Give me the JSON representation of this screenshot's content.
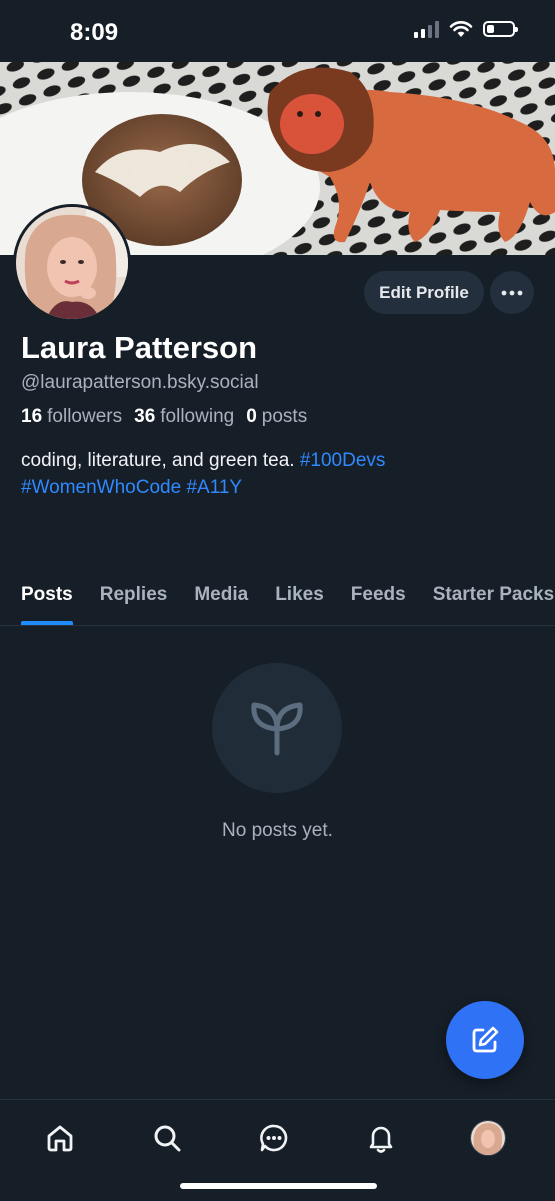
{
  "status_bar": {
    "time": "8:09",
    "battery_level": 0.3
  },
  "profile": {
    "display_name": "Laura Patterson",
    "handle": "@laurapatterson.bsky.social",
    "followers_count": "16",
    "followers_label": "followers",
    "following_count": "36",
    "following_label": "following",
    "posts_count": "0",
    "posts_label": "posts",
    "bio_text": "coding, literature, and green tea.",
    "bio_tags": [
      "#100Devs",
      "#WomenWhoCode",
      "#A11Y"
    ]
  },
  "actions": {
    "edit_profile_label": "Edit Profile"
  },
  "tabs": [
    {
      "label": "Posts",
      "active": true
    },
    {
      "label": "Replies",
      "active": false
    },
    {
      "label": "Media",
      "active": false
    },
    {
      "label": "Likes",
      "active": false
    },
    {
      "label": "Feeds",
      "active": false
    },
    {
      "label": "Starter Packs",
      "active": false
    }
  ],
  "empty_state": {
    "message": "No posts yet.",
    "icon": "sprout-icon"
  },
  "bottom_nav": [
    {
      "name": "home",
      "icon": "home-icon"
    },
    {
      "name": "search",
      "icon": "search-icon"
    },
    {
      "name": "chat",
      "icon": "chat-icon"
    },
    {
      "name": "notifications",
      "icon": "bell-icon"
    },
    {
      "name": "profile",
      "icon": "avatar"
    }
  ],
  "colors": {
    "background": "#161e27",
    "accent": "#208bfe",
    "fab": "#2f72f5",
    "hashtag": "#2f89ff"
  }
}
